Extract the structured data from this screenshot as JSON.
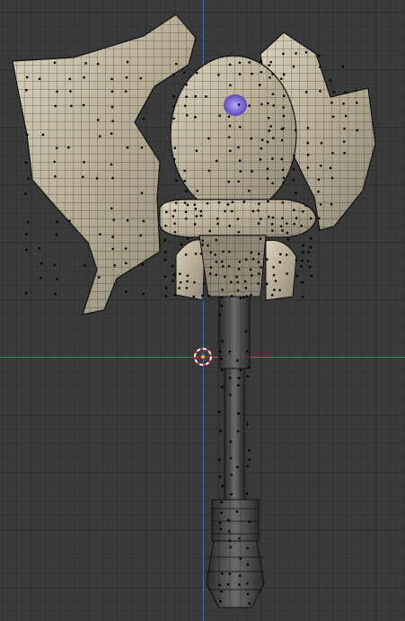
{
  "viewport": {
    "name": "3d-viewport",
    "mode": "edit-mode",
    "axes": {
      "x_color": "#b8454f",
      "y_color": "#3f6fb7"
    },
    "object": {
      "name": "",
      "type": "mesh-axe",
      "material_color": "#c9c0a8"
    }
  }
}
